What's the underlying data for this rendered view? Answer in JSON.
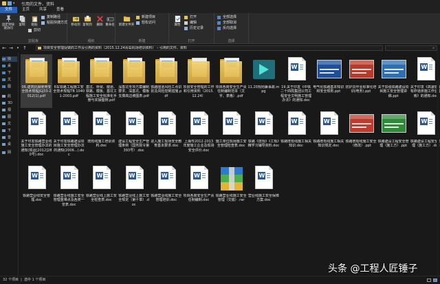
{
  "window": {
    "title": "引用的文件、资料",
    "quick_access": [
      "folder-icon",
      "save-icon",
      "dropdown-icon"
    ]
  },
  "ribbon_tabs": [
    "文件",
    "主页",
    "共享",
    "查看"
  ],
  "ribbon": {
    "clipboard": {
      "pin_label": "固定到快速访问",
      "copy_label": "复制",
      "paste_label": "粘贴",
      "copy_path_label": "复制路径",
      "paste_shortcut_label": "粘贴快捷方式",
      "cut_label": "剪切",
      "group_label": "剪贴板"
    },
    "organize": {
      "move_to_label": "移动到",
      "copy_to_label": "复制到",
      "delete_label": "删除",
      "rename_label": "重命名",
      "group_label": "组织"
    },
    "new": {
      "new_folder_label": "新建文件夹",
      "new_item_label": "新建项目",
      "easy_access_label": "轻松访问",
      "group_label": "新建"
    },
    "open": {
      "properties_label": "属性",
      "open_label": "打开",
      "edit_label": "编辑",
      "history_label": "历史记录",
      "group_label": "打开"
    },
    "select": {
      "select_all_label": "全部选择",
      "select_none_label": "全部取消",
      "invert_label": "反向选择",
      "group_label": "选择"
    }
  },
  "address": {
    "path_1": "项目安全管理促做的工作及引用的资料（2015.12.24青岛机场培训资料）",
    "sep": "›",
    "path_2": "引用的文件、资料",
    "search_placeholder": ""
  },
  "nav_pane": {
    "items": [
      "快",
      "桌",
      "下",
      "文",
      "图",
      "此",
      "3D",
      "视",
      "图",
      "文",
      "下",
      "音",
      "桌",
      "网"
    ]
  },
  "files": [
    {
      "name": "06.建筑机械使用安全技术规程JGJ33-2012(1).pdf",
      "type": "folder-doc"
    },
    {
      "name": "6车铁路工程施工安全技术规程TB 10401-2003.pdf",
      "type": "folder-doc"
    },
    {
      "name": "基坑、桥梁、隧道、铁路、模板、基坑工程施工安全标准化手册与实操图例.pdf",
      "type": "folder-doc"
    },
    {
      "name": "深基坑专项方案编制要求、深基坑、模板支撑高边坡图表.pdf",
      "type": "folder-doc"
    },
    {
      "name": "铁路隧道风险工点识别及风险控制措施.pdf",
      "type": "folder-doc"
    },
    {
      "name": "项目安全管理的工作和引用资料（2015.12.24）",
      "type": "folder"
    },
    {
      "name": "项目各岗安全生产责任制编制范本（文字、表格）.pdf",
      "type": "folder-doc"
    },
    {
      "name": "11.20规则兼事故.mpg",
      "type": "video"
    },
    {
      "name": "19.关于印发《中铁二十四局集团公司工程安全文明施工管理办法》的通知.doc",
      "type": "doc"
    },
    {
      "name": "电气化铁路基本知识和安全规则.ppt",
      "type": "ppt",
      "color": "#1f4e9b"
    },
    {
      "name": "防护员作业标准化培训(电务).ppt",
      "type": "ppt",
      "color": "#b83a2b"
    },
    {
      "name": "关于加强铁路建设项目施工安全管理讲稿.ppt",
      "type": "ppt",
      "color": "#2f6fb1"
    },
    {
      "name": "关于印发《高速铁路有砟道床施工作业指南》的通知.doc",
      "type": "doc"
    },
    {
      "name": "关于印发铁路营业线施工安全管理办法的通知(铁运[2012]280号).doc",
      "type": "doc"
    },
    {
      "name": "关于印发铁路建设项目施工安全管理办法的通知(2006...).doc",
      "type": "doc"
    },
    {
      "name": "既有线施工培训资料.doc",
      "type": "doc"
    },
    {
      "name": "建设工程安全生产管理条例（国务院令第393号）.doc",
      "type": "doc"
    },
    {
      "name": "进入施工现场安全教育基本要求.doc",
      "type": "doc"
    },
    {
      "name": "上海市2012-2013年度施工企业及现场安全评价.doc",
      "type": "doc"
    },
    {
      "name": "施工单位现场施工安全管理检查表.doc",
      "type": "doc"
    },
    {
      "name": "铁路《技规》《工规》精学习辅导资料.doc",
      "type": "doc"
    },
    {
      "name": "铁路既有线施工相关知识.doc",
      "type": "doc"
    },
    {
      "name": "铁路既有线施工相关知识规定.doc",
      "type": "doc"
    },
    {
      "name": "铁路既有线施工安全（修改）.ppt",
      "type": "ppt",
      "color": "#c03a2e"
    },
    {
      "name": "铁路建设工程安全管理（施工方）.ppt",
      "type": "ppt",
      "color": "#2e8b3a"
    },
    {
      "name": "铁路建设工程安全管理（施工方）.doc",
      "type": "doc"
    },
    {
      "name": "铁路营业线安全管理.doc",
      "type": "doc"
    },
    {
      "name": "铁路营业线施工安全管理重难点及各类一览表.doc",
      "type": "doc"
    },
    {
      "name": "铁路营业线上施工安全检查表.doc",
      "type": "doc"
    },
    {
      "name": "铁路营业线上施工安全规定（第十章）.doc",
      "type": "doc"
    },
    {
      "name": "铁路营业线施工安全管理培训.doc",
      "type": "doc"
    },
    {
      "name": "项目各岗安全生产责任制编制.doc",
      "type": "doc"
    },
    {
      "name": "铁路营业线施工安全管理（交底）.rar",
      "type": "rar"
    },
    {
      "name": "营业线施工安全保障方案.doc",
      "type": "doc"
    }
  ],
  "status": {
    "items_count": "32 个项目",
    "selected": "选中 1 个项目"
  },
  "watermark": "头条 @工程人匠锤子"
}
